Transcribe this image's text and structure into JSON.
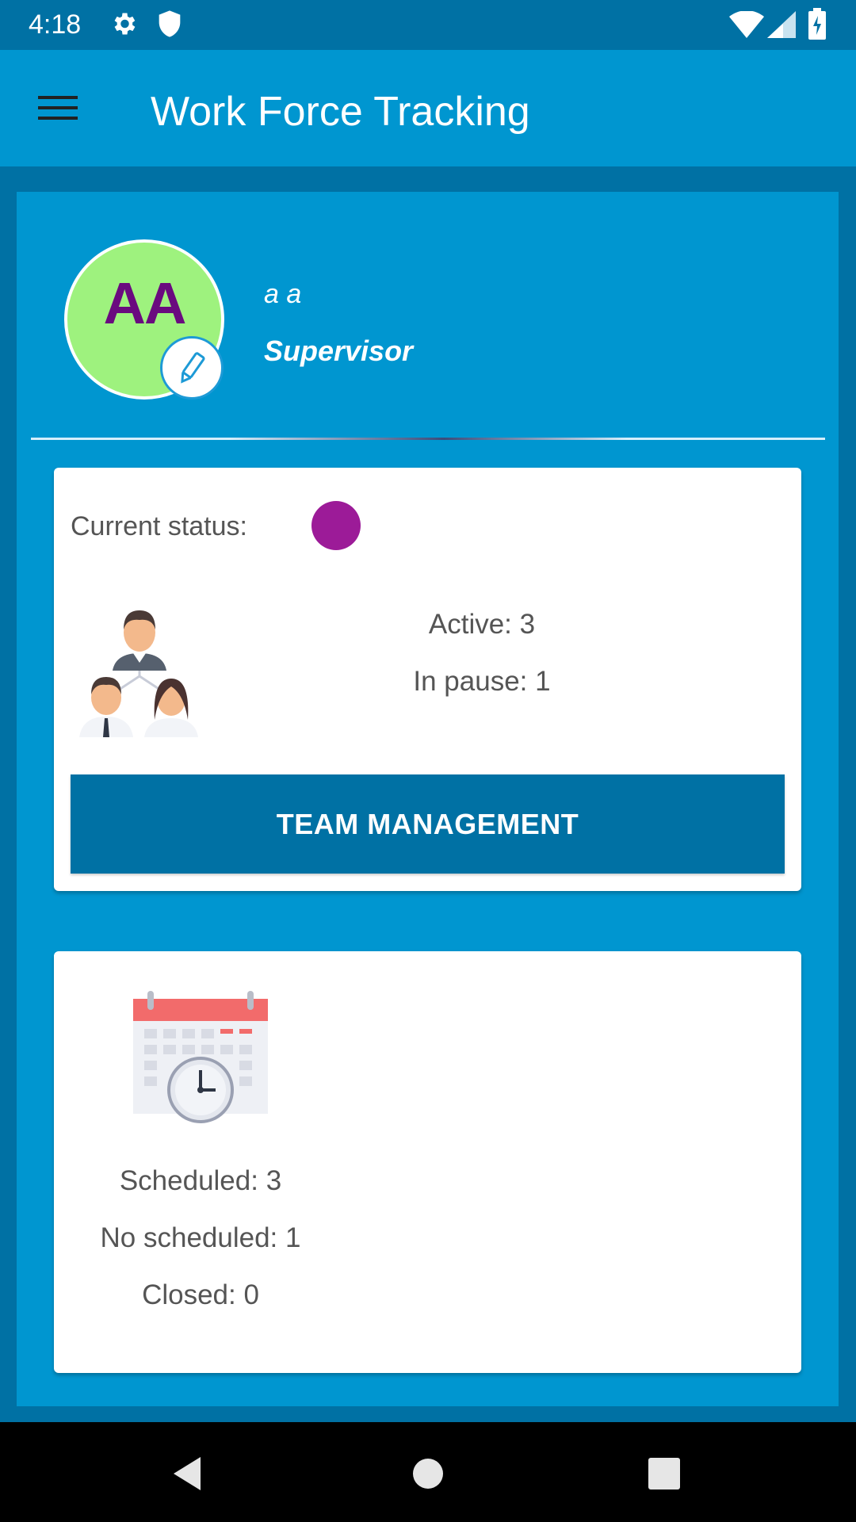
{
  "status_bar": {
    "time": "4:18",
    "icons": [
      "settings-icon",
      "shield-icon",
      "wifi-icon",
      "signal-icon",
      "battery-icon"
    ]
  },
  "app_bar": {
    "title": "Work Force Tracking",
    "menu_icon": "hamburger-menu-icon"
  },
  "profile": {
    "initials": "AA",
    "name": "a a",
    "role": "Supervisor",
    "avatar_color": "#9ef27e",
    "initials_color": "#6a0a7f"
  },
  "status_card": {
    "status_label": "Current status:",
    "status_color": "#9c1b98",
    "active": "Active: 3",
    "in_pause": "In pause: 1",
    "button_label": "TEAM MANAGEMENT"
  },
  "schedule_card": {
    "scheduled": "Scheduled: 3",
    "no_scheduled": "No scheduled: 1",
    "closed": "Closed: 0"
  },
  "nav_bar": {
    "buttons": [
      "back-icon",
      "home-icon",
      "recents-icon"
    ]
  },
  "colors": {
    "primary": "#0096d0",
    "primary_dark": "#0071a4",
    "card_bg": "#ffffff",
    "text_gray": "#555555"
  }
}
